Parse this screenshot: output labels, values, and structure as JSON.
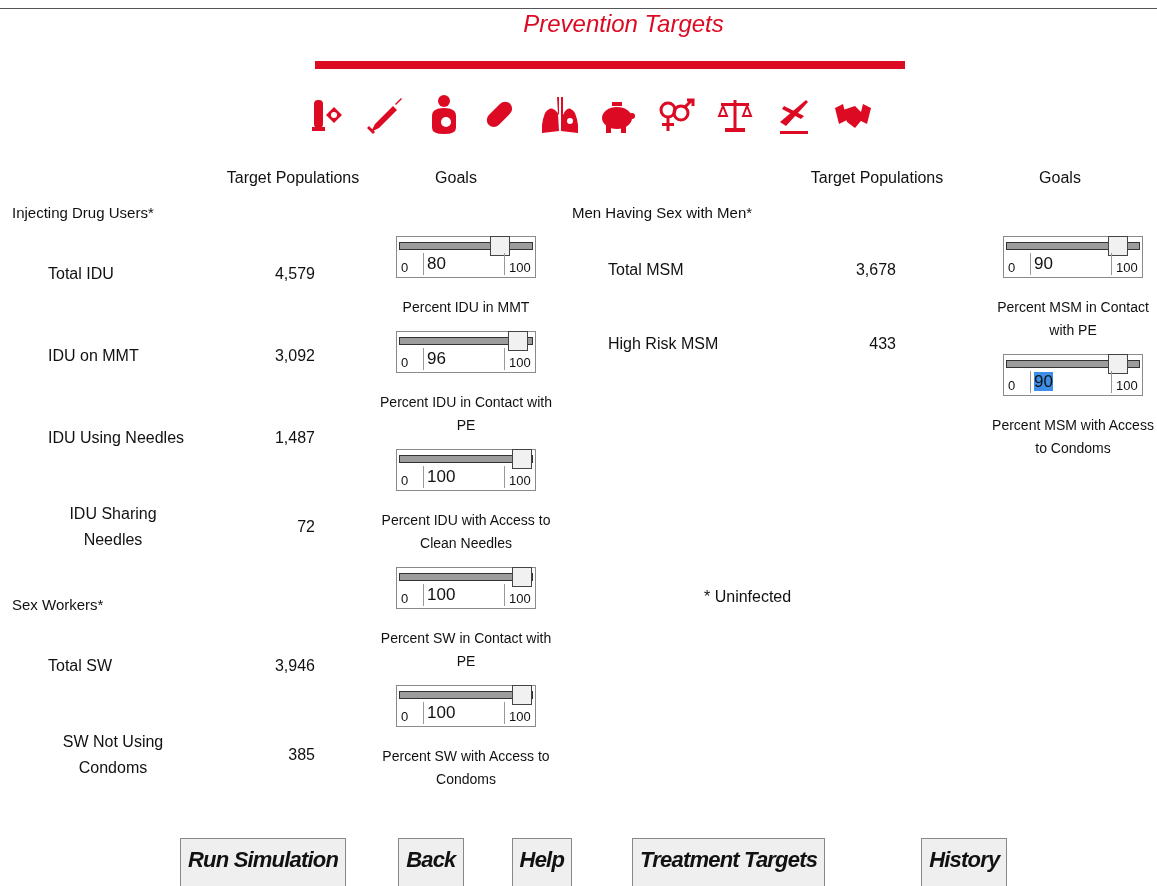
{
  "title": "Prevention Targets",
  "left": {
    "header_population": "Target Populations",
    "header_goals": "Goals",
    "groups": [
      {
        "heading": "Injecting Drug Users*",
        "rows": [
          {
            "label": "Total IDU",
            "value": "4,579",
            "kind": "single"
          },
          {
            "label": "IDU on MMT",
            "value": "3,092",
            "kind": "single"
          },
          {
            "label": "IDU Using Needles",
            "value": "1,487",
            "kind": "single"
          },
          {
            "label": "IDU Sharing Needles",
            "value": "72",
            "kind": "wrapped"
          }
        ]
      },
      {
        "heading": "Sex Workers*",
        "rows": [
          {
            "label": "Total SW",
            "value": "3,946",
            "kind": "single"
          },
          {
            "label": "SW Not Using Condoms",
            "value": "385",
            "kind": "wrapped"
          }
        ]
      }
    ],
    "goals": [
      {
        "min": "0",
        "max": "100",
        "value": "80",
        "level": 0.8,
        "highlighted": false,
        "caption": "Percent IDU in MMT"
      },
      {
        "min": "0",
        "max": "100",
        "value": "96",
        "level": 0.96,
        "highlighted": false,
        "caption": "Percent IDU in Contact with PE"
      },
      {
        "min": "0",
        "max": "100",
        "value": "100",
        "level": 1,
        "highlighted": false,
        "caption": "Percent IDU with Access to Clean Needles"
      },
      {
        "min": "0",
        "max": "100",
        "value": "100",
        "level": 1,
        "highlighted": false,
        "caption": "Percent SW in Contact with PE"
      },
      {
        "min": "0",
        "max": "100",
        "value": "100",
        "level": 1,
        "highlighted": false,
        "caption": "Percent SW with Access to Condoms"
      }
    ]
  },
  "right": {
    "header_population": "Target Populations",
    "header_goals": "Goals",
    "groups": [
      {
        "heading": "Men Having Sex with Men*",
        "rows": [
          {
            "label": "Total MSM",
            "value": "3,678",
            "kind": "single"
          },
          {
            "label": "High Risk MSM",
            "value": "433",
            "kind": "single"
          }
        ]
      }
    ],
    "note": "* Uninfected",
    "goals": [
      {
        "min": "0",
        "max": "100",
        "value": "90",
        "level": 0.9,
        "highlighted": false,
        "caption": "Percent MSM in Contact with PE"
      },
      {
        "min": "0",
        "max": "100",
        "value": "90",
        "level": 0.9,
        "highlighted": true,
        "caption": "Percent MSM with Access to Condoms"
      }
    ]
  },
  "buttons": [
    "Run Simulation",
    "Back",
    "Help",
    "Treatment Targets",
    "History"
  ]
}
